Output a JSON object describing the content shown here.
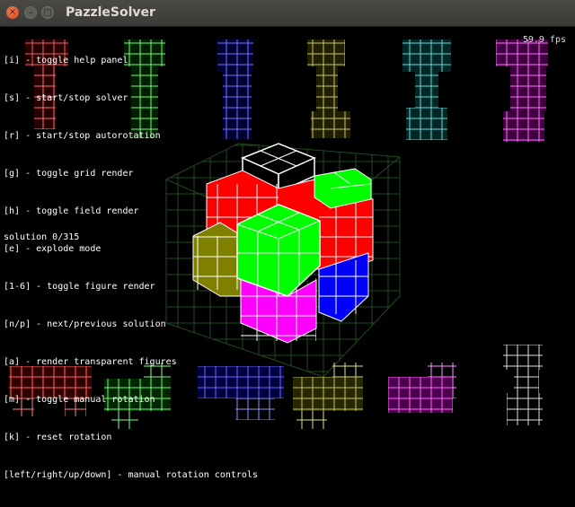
{
  "window": {
    "title": "PazzleSolver"
  },
  "window_controls": {
    "close_glyph": "×",
    "minimize_glyph": "–",
    "maximize_glyph": "□"
  },
  "overlay": {
    "help_lines": [
      "[i] - toggle help panel",
      "[s] - start/stop solver",
      "[r] - start/stop autorotation",
      "[g] - toggle grid render",
      "[h] - toggle field render",
      "[e] - explode mode",
      "[1-6] - toggle figure render",
      "[n/p] - next/previous solution",
      "[a] - render transparent figures",
      "[m] - toggle manual rotation",
      "[k] - reset rotation",
      "[left/right/up/down] - manual rotation controls"
    ],
    "fps": "59.9 fps",
    "solution": "solution 0/315"
  },
  "colors": {
    "red": "#ff0000",
    "green": "#00ff00",
    "blue": "#0000ff",
    "olive": "#808000",
    "cyan": "#00c0c0",
    "magenta": "#ff00ff",
    "white": "#ffffff",
    "grid": "#1f4a1f"
  }
}
